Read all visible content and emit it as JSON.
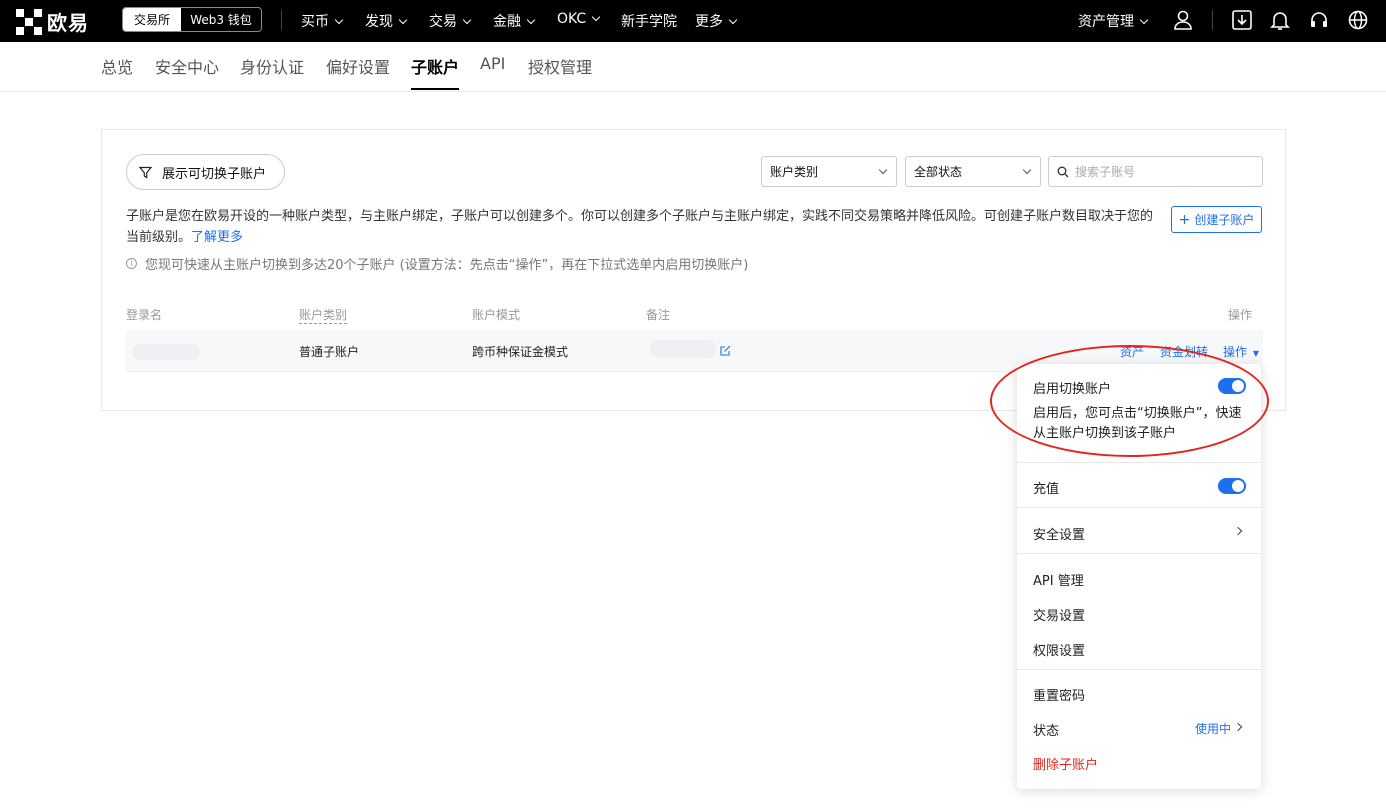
{
  "topnav": {
    "logo_text": "欧易",
    "switch_exchange": "交易所",
    "switch_web3": "Web3 钱包",
    "items": [
      {
        "label": "买币"
      },
      {
        "label": "发现"
      },
      {
        "label": "交易"
      },
      {
        "label": "金融"
      },
      {
        "label": "OKC"
      },
      {
        "label": "新手学院"
      },
      {
        "label": "更多"
      }
    ],
    "assets": "资产管理"
  },
  "subnav": {
    "tabs": [
      {
        "label": "总览"
      },
      {
        "label": "安全中心"
      },
      {
        "label": "身份认证"
      },
      {
        "label": "偏好设置"
      },
      {
        "label": "子账户"
      },
      {
        "label": "API"
      },
      {
        "label": "授权管理"
      }
    ],
    "active": "子账户"
  },
  "toolbar": {
    "filter_label": "展示可切换子账户",
    "account_type": "账户类别",
    "all_status": "全部状态",
    "search_placeholder": "搜索子账号"
  },
  "description": {
    "text": "子账户是您在欧易开设的一种账户类型，与主账户绑定，子账户可以创建多个。你可以创建多个子账户与主账户绑定，实践不同交易策略并降低风险。可创建子账户数目取决于您的当前级别。",
    "learn_more": "了解更多",
    "create_button": "创建子账户",
    "tip": "您现可快速从主账户切换到多达20个子账户 (设置方法：先点击“操作”，再在下拉式选单内启用切换账户)"
  },
  "table": {
    "headers": [
      "登录名",
      "账户类别",
      "账户模式",
      "备注",
      "操作"
    ],
    "rows": [
      {
        "type": "普通子账户",
        "mode": "跨币种保证金模式",
        "actions": [
          "资产",
          "资金划转",
          "操作"
        ]
      }
    ]
  },
  "dropdown": {
    "switch_title": "启用切换账户",
    "switch_desc": "启用后，您可点击“切换账户”，快速从主账户切换到该子账户",
    "deposit": "充值",
    "security": "安全设置",
    "api": "API 管理",
    "trade_settings": "交易设置",
    "permissions": "权限设置",
    "reset_password": "重置密码",
    "status": "状态",
    "status_value": "使用中",
    "delete": "删除子账户"
  },
  "colors": {
    "accent": "#1e6ff0",
    "danger": "#e3261d",
    "nav_bg": "#000000"
  }
}
